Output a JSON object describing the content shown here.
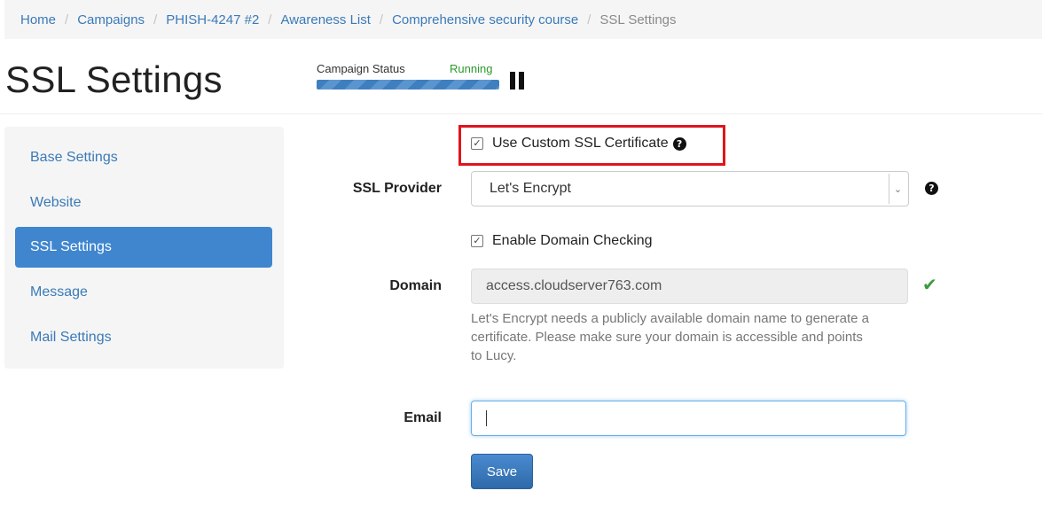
{
  "breadcrumb": {
    "items": [
      "Home",
      "Campaigns",
      "PHISH-4247 #2",
      "Awareness List",
      "Comprehensive security course"
    ],
    "active": "SSL Settings",
    "separator": "/"
  },
  "page": {
    "title": "SSL Settings"
  },
  "campaign_status": {
    "label": "Campaign Status",
    "value": "Running",
    "progress_percent": 100,
    "pause_icon": "pause-icon"
  },
  "sidebar": {
    "items": [
      {
        "label": "Base Settings"
      },
      {
        "label": "Website"
      },
      {
        "label": "SSL Settings",
        "active": true
      },
      {
        "label": "Message"
      },
      {
        "label": "Mail Settings"
      }
    ]
  },
  "form": {
    "custom_ssl": {
      "label": "Use Custom SSL Certificate",
      "checked": true,
      "help_icon": "question-circle-icon"
    },
    "ssl_provider": {
      "label": "SSL Provider",
      "value": "Let's Encrypt",
      "help_icon": "question-circle-icon"
    },
    "domain_checking": {
      "label": "Enable Domain Checking",
      "checked": true
    },
    "domain": {
      "label": "Domain",
      "value": "access.cloudserver763.com",
      "status_icon": "checkmark-icon"
    },
    "help_text": "Let's Encrypt needs a publicly available domain name to generate a certificate. Please make sure your domain is accessible and points to Lucy.",
    "email": {
      "label": "Email",
      "value": ""
    },
    "save_label": "Save"
  },
  "colors": {
    "link": "#3a7ab8",
    "active_nav": "#3f86cf",
    "running": "#2a9a2a",
    "highlight_border": "#e0141e",
    "save_button": "#3a79bd"
  }
}
